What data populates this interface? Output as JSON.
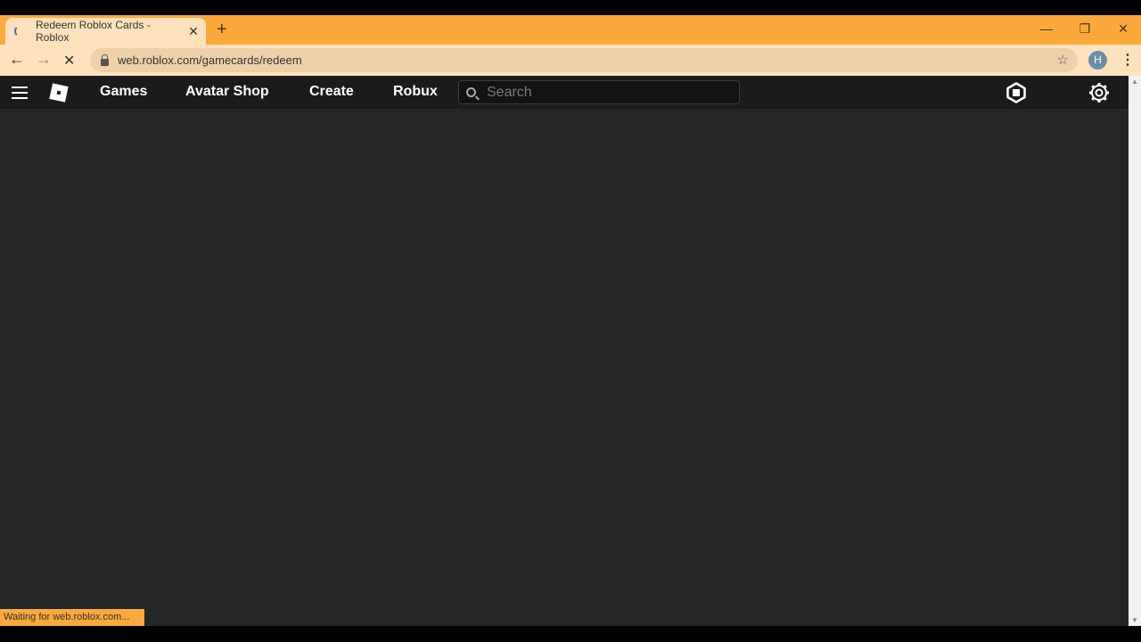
{
  "browser": {
    "tab_title": "Redeem Roblox Cards - Roblox",
    "url": "web.roblox.com/gamecards/redeem",
    "profile_initial": "H",
    "status_text": "Waiting for web.roblox.com...",
    "accent_color": "#fca93b"
  },
  "nav": {
    "links": [
      "Games",
      "Avatar Shop",
      "Create",
      "Robux"
    ],
    "search_placeholder": "Search"
  }
}
